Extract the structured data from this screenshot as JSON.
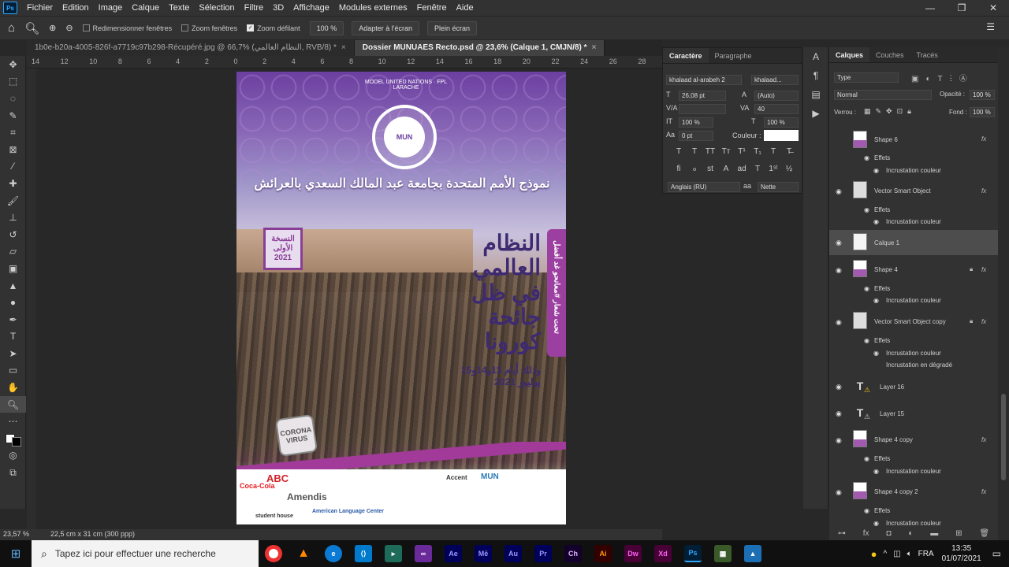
{
  "menubar": {
    "app_icon": "Ps",
    "items": [
      "Fichier",
      "Edition",
      "Image",
      "Calque",
      "Texte",
      "Sélection",
      "Filtre",
      "3D",
      "Affichage",
      "Modules externes",
      "Fenêtre",
      "Aide"
    ],
    "controls": [
      "—",
      "❐",
      "✕"
    ]
  },
  "options": {
    "resize_windows": "Redimensionner fenêtres",
    "zoom_windows": "Zoom fenêtres",
    "scrubby_zoom": "Zoom défilant",
    "zoom_value": "100 %",
    "fit_screen": "Adapter à l'écran",
    "fill_screen": "Plein écran"
  },
  "tabs": [
    {
      "label": "1b0e-b20a-4005-826f-a7719c97b298-Récupéré.jpg @ 66,7% (النظام العالمي, RVB/8) *",
      "active": false
    },
    {
      "label": "Dossier MUNUAES Recto.psd @ 23,6% (Calque 1, CMJN/8) *",
      "active": true
    }
  ],
  "ruler_top": [
    "14",
    "12",
    "10",
    "8",
    "6",
    "4",
    "2",
    "0",
    "2",
    "4",
    "6",
    "8",
    "10",
    "12",
    "14",
    "16",
    "18",
    "20",
    "22",
    "24",
    "26",
    "28"
  ],
  "poster": {
    "emblem_ring": "MODEL UNITED NATIONS · FPL LARACHE",
    "emblem_center": "MUN",
    "title_ar": "نموذج الأمم المتحدة بجامعة عبد المالك السعدي بالعرائش",
    "edition_badge": "النسخة الأولى 2021",
    "main_title_ar": "النظام العالمي في ظل جائحة كورونا",
    "vertical_slogan": "تحت شعار #معانحو غد أفضل",
    "dates_ar": "وذلك أيام 13و14و15 يوليوز 2021",
    "corona_sign": "CORONA VIRUS",
    "sponsors": [
      "Coca-Cola",
      "ABC",
      "Amendis",
      "student house",
      "American Language Center",
      "MUN",
      "Accent"
    ]
  },
  "character_panel": {
    "tabs": [
      "Caractère",
      "Paragraphe"
    ],
    "font_family": "khalaad al-arabeh 2",
    "font_style": "khalaad...",
    "size": "26,08 pt",
    "leading": "(Auto)",
    "kerning": "",
    "tracking": "40",
    "vscale": "100 %",
    "hscale": "100 %",
    "baseline": "0 pt",
    "color_label": "Couleur :",
    "language": "Anglais (RU)",
    "antialias": "Nette",
    "style_glyphs": [
      "T",
      "T",
      "TT",
      "Tт",
      "T¹",
      "T₁",
      "T",
      "T̶"
    ],
    "ot_glyphs": [
      "ﬁ",
      "ℴ",
      "st",
      "A",
      "ad",
      "T",
      "1ˢᵗ",
      "½"
    ]
  },
  "layers_panel": {
    "tabs": [
      "Calques",
      "Couches",
      "Tracés"
    ],
    "filter": "Type",
    "blend_mode": "Normal",
    "opacity_label": "Opacité :",
    "opacity": "100 %",
    "lock_label": "Verrou :",
    "fill_label": "Fond :",
    "fill": "100 %",
    "effects_label": "Effets",
    "layers": [
      {
        "name": "Shape 6",
        "effects": [
          "Incrustation couleur"
        ]
      },
      {
        "name": "Vector Smart Object",
        "effects": [
          "Incrustation couleur"
        ]
      },
      {
        "name": "Calque 1",
        "effects": [],
        "selected": true
      },
      {
        "name": "Shape 4",
        "effects": [
          "Incrustation couleur"
        ]
      },
      {
        "name": "Vector Smart Object copy",
        "effects": [
          "Incrustation couleur",
          "Incrustation en dégradé"
        ]
      },
      {
        "name": "Layer 16",
        "effects": []
      },
      {
        "name": "Layer 15",
        "effects": []
      },
      {
        "name": "Shape 4 copy",
        "effects": [
          "Incrustation couleur"
        ]
      },
      {
        "name": "Shape 4 copy 2",
        "effects": [
          "Incrustation couleur"
        ]
      }
    ]
  },
  "status": {
    "zoom": "23,57 %",
    "doc_size": "22,5 cm x 31 cm (300 ppp)"
  },
  "taskbar": {
    "search_placeholder": "Tapez ici pour effectuer une recherche",
    "apps": [
      "Ae",
      "Mē",
      "Au",
      "Pr",
      "Ch",
      "Ai",
      "Dw",
      "Xd",
      "Ps"
    ],
    "lang": "FRA",
    "time": "13:35",
    "date": "01/07/2021"
  },
  "colors": {
    "accent_purple": "#6b3fa0",
    "magenta": "#a13a98",
    "ps_blue": "#31a8ff"
  }
}
